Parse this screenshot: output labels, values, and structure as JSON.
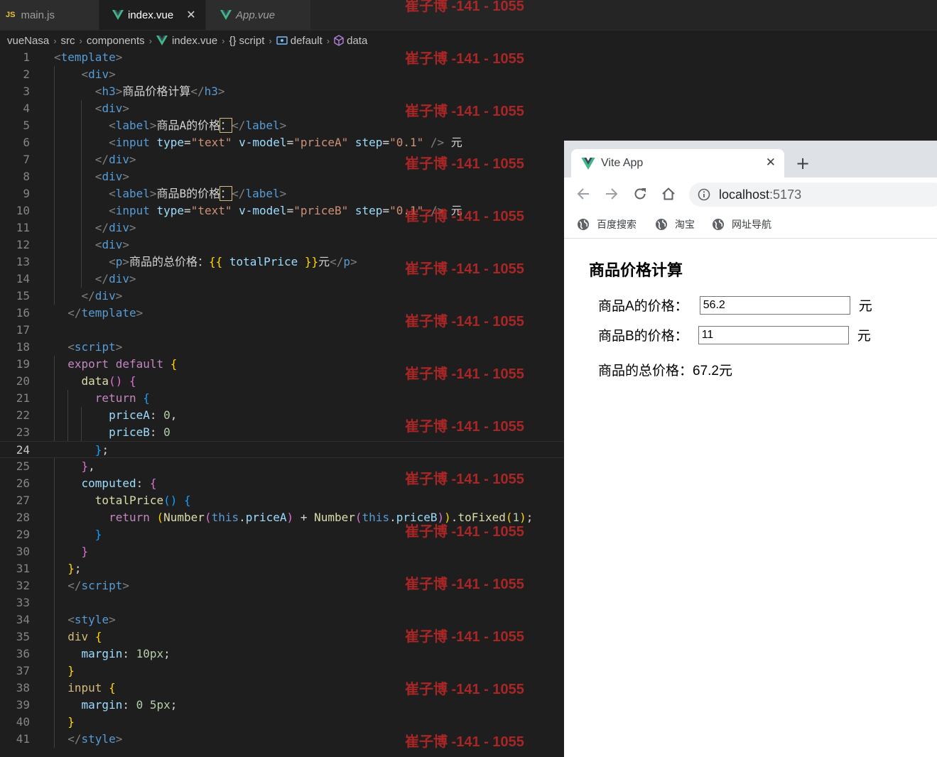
{
  "editor": {
    "tabs": [
      {
        "label": "main.js",
        "badge": "JS",
        "active": false,
        "italic": false
      },
      {
        "label": "index.vue",
        "active": true,
        "italic": false
      },
      {
        "label": "App.vue",
        "active": false,
        "italic": true
      }
    ],
    "tab_close_glyph": "✕",
    "breadcrumb": [
      "vueNasa",
      "src",
      "components",
      "index.vue",
      "script",
      "default",
      "data"
    ],
    "breadcrumb_sep": "›",
    "current_line": 24
  },
  "watermark": "崔子博 -141 - 1055",
  "browser": {
    "tab_title": "Vite App",
    "tab_close_glyph": "✕",
    "new_tab_glyph": "+",
    "url_host": "localhost",
    "url_port": ":5173",
    "bookmarks": [
      "百度搜索",
      "淘宝",
      "网址导航"
    ],
    "page": {
      "title": "商品价格计算",
      "price_a_label": "商品A的价格：",
      "price_a_value": "56.2",
      "price_b_label": "商品B的价格：",
      "price_b_value": "11",
      "unit": "元",
      "total_label": "商品的总价格：",
      "total_value": "67.2元"
    }
  },
  "icons": {
    "vue": "vue-logo-icon",
    "back": "arrow-left-icon",
    "forward": "arrow-right-icon",
    "reload": "reload-icon",
    "home": "home-icon",
    "info": "info-icon",
    "globe": "globe-icon"
  },
  "colors": {
    "editor_bg": "#1e1e1e",
    "vue_green": "#41b883",
    "vue_dark": "#35495e",
    "watermark": "#c82828"
  }
}
